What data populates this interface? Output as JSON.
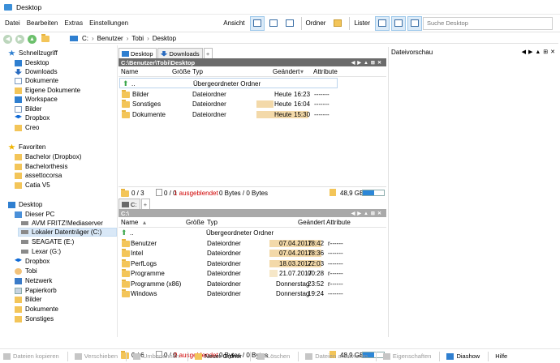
{
  "window": {
    "title": "Desktop"
  },
  "menu": [
    "Datei",
    "Bearbeiten",
    "Extras",
    "Einstellungen"
  ],
  "toolbar": {
    "ansicht": "Ansicht",
    "ordner": "Ordner",
    "lister": "Lister",
    "search_placeholder": "Suche Desktop"
  },
  "address": {
    "parts": [
      "C:",
      "Benutzer",
      "Tobi",
      "Desktop"
    ]
  },
  "sidebar": {
    "quick_access": "Schnellzugriff",
    "quick_items": [
      "Desktop",
      "Downloads",
      "Dokumente",
      "Eigene Dokumente",
      "Workspace",
      "Bilder",
      "Dropbox",
      "Creo"
    ],
    "favorites": "Favoriten",
    "fav_items": [
      "Bachelor (Dropbox)",
      "Bachelorthesis",
      "assettocorsa",
      "Catia V5"
    ],
    "desktop": "Desktop",
    "this_pc": "Dieser PC",
    "pc_items": [
      "AVM FRITZ!Mediaserver",
      "Lokaler Datenträger (C:)",
      "SEAGATE (E:)",
      "Lexar (G:)"
    ],
    "desk_items": [
      "Dropbox",
      "Tobi",
      "Netzwerk",
      "Papierkorb",
      "Bilder",
      "Dokumente",
      "Sonstiges"
    ]
  },
  "top_pane": {
    "tabs": [
      "Desktop",
      "Downloads",
      "+"
    ],
    "path": "C:\\Benutzer\\Tobi\\Desktop",
    "columns": [
      "Name",
      "Größe",
      "Typ",
      "Geändert",
      "Attribute"
    ],
    "up_row": {
      "name": "..",
      "type": "Übergeordneter Ordner"
    },
    "rows": [
      {
        "name": "Bilder",
        "type": "Dateiordner",
        "date": "Heute",
        "time": "16:23",
        "attr": "-------"
      },
      {
        "name": "Sonstiges",
        "type": "Dateiordner",
        "date": "Heute",
        "time": "16:04",
        "attr": "-------"
      },
      {
        "name": "Dokumente",
        "type": "Dateiordner",
        "date": "Heute",
        "time": "15:30",
        "attr": "-------"
      }
    ],
    "status": {
      "folders": "0 / 3",
      "files": "0 / 0",
      "hidden": "1 ausgeblendet",
      "bytes": "0 Bytes / 0 Bytes",
      "free": "48,9 GB",
      "used_fraction": 0.55
    }
  },
  "bottom_pane": {
    "tabs": [
      "C:",
      "+"
    ],
    "path": "C:\\",
    "columns": [
      "Name",
      "Größe",
      "Typ",
      "Geändert",
      "Attribute"
    ],
    "up_row": {
      "name": "..",
      "type": "Übergeordneter Ordner"
    },
    "rows": [
      {
        "name": "Benutzer",
        "type": "Dateiordner",
        "date": "07.04.2017",
        "time": "18:42",
        "attr": "r------"
      },
      {
        "name": "Intel",
        "type": "Dateiordner",
        "date": "07.04.2017",
        "time": "18:36",
        "attr": "-------"
      },
      {
        "name": "PerfLogs",
        "type": "Dateiordner",
        "date": "18.03.2017",
        "time": "22:03",
        "attr": "-------"
      },
      {
        "name": "Programme",
        "type": "Dateiordner",
        "date": "21.07.2017",
        "time": "00:28",
        "attr": "r------"
      },
      {
        "name": "Programme (x86)",
        "type": "Dateiordner",
        "date": "Donnerstag",
        "time": "23:52",
        "attr": "r------"
      },
      {
        "name": "Windows",
        "type": "Dateiordner",
        "date": "Donnerstag",
        "time": "19:24",
        "attr": "-------"
      }
    ],
    "status": {
      "folders": "0 / 6",
      "files": "0 / 0",
      "hidden": "9 ausgeblendet",
      "bytes": "0 Bytes / 0 Bytes",
      "free": "48,9 GB",
      "used_fraction": 0.55
    }
  },
  "preview": {
    "title": "Dateivorschau"
  },
  "bottom_toolbar": [
    "Dateien kopieren",
    "Verschieben",
    "Umbenennen",
    "Neuer Ordner",
    "Löschen",
    "Dateien archivieren",
    "Eigenschaften",
    "Diashow",
    "Hilfe"
  ]
}
